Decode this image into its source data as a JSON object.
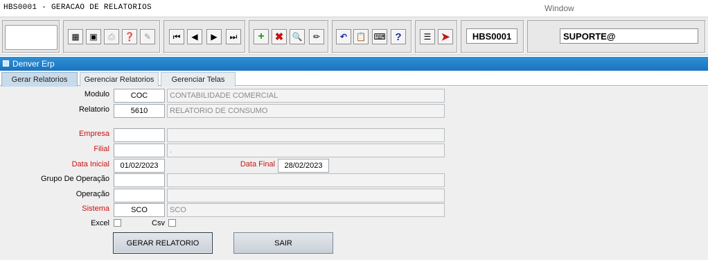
{
  "window": {
    "title": "HBS0001 - GERACAO DE RELATORIOS",
    "menu_label": "Window"
  },
  "toolbar": {
    "icons": [
      "save-icon",
      "screen-icon",
      "print-icon",
      "query-icon",
      "edit-icon",
      "first-icon",
      "prev-icon",
      "next-icon",
      "last-icon",
      "add-icon",
      "delete-icon",
      "search-icon",
      "clear-icon",
      "undo-icon",
      "clipboard-icon",
      "keys-icon",
      "help-icon",
      "menu-icon",
      "exit-icon"
    ],
    "help_glyph": "?",
    "form_code": "HBS0001",
    "user": "SUPORTE@"
  },
  "app": {
    "title": "Denver Erp"
  },
  "tabs": [
    {
      "label": "Gerar Relatorios",
      "active": true
    },
    {
      "label": "Gerenciar Relatorios",
      "active": false
    },
    {
      "label": "Gerenciar Telas",
      "active": false
    }
  ],
  "form": {
    "modulo": {
      "label": "Modulo",
      "code": "COC",
      "description": "CONTABILIDADE COMERCIAL"
    },
    "relatorio": {
      "label": "Relatorio",
      "code": "5610",
      "description": "RELATORIO DE CONSUMO"
    },
    "empresa": {
      "label": "Empresa",
      "code": "",
      "description": ""
    },
    "filial": {
      "label": "Filial",
      "code": "",
      "description": "."
    },
    "data_inicial": {
      "label": "Data Inicial",
      "value": "01/02/2023"
    },
    "data_final": {
      "label": "Data Final",
      "value": "28/02/2023"
    },
    "grupo_operacao": {
      "label": "Grupo De Operação",
      "code": "",
      "description": ""
    },
    "operacao": {
      "label": "Operação",
      "code": "",
      "description": ""
    },
    "sistema": {
      "label": "Sistema",
      "code": "SCO",
      "description": "SCO"
    },
    "excel": {
      "label": "Excel",
      "checked": false
    },
    "csv": {
      "label": "Csv",
      "checked": false
    }
  },
  "buttons": {
    "gerar": "GERAR RELATORIO",
    "sair": "SAIR"
  },
  "colors": {
    "required_label": "#cc1010",
    "appbar": "#1b74c0",
    "active_tab": "#c9daea"
  }
}
